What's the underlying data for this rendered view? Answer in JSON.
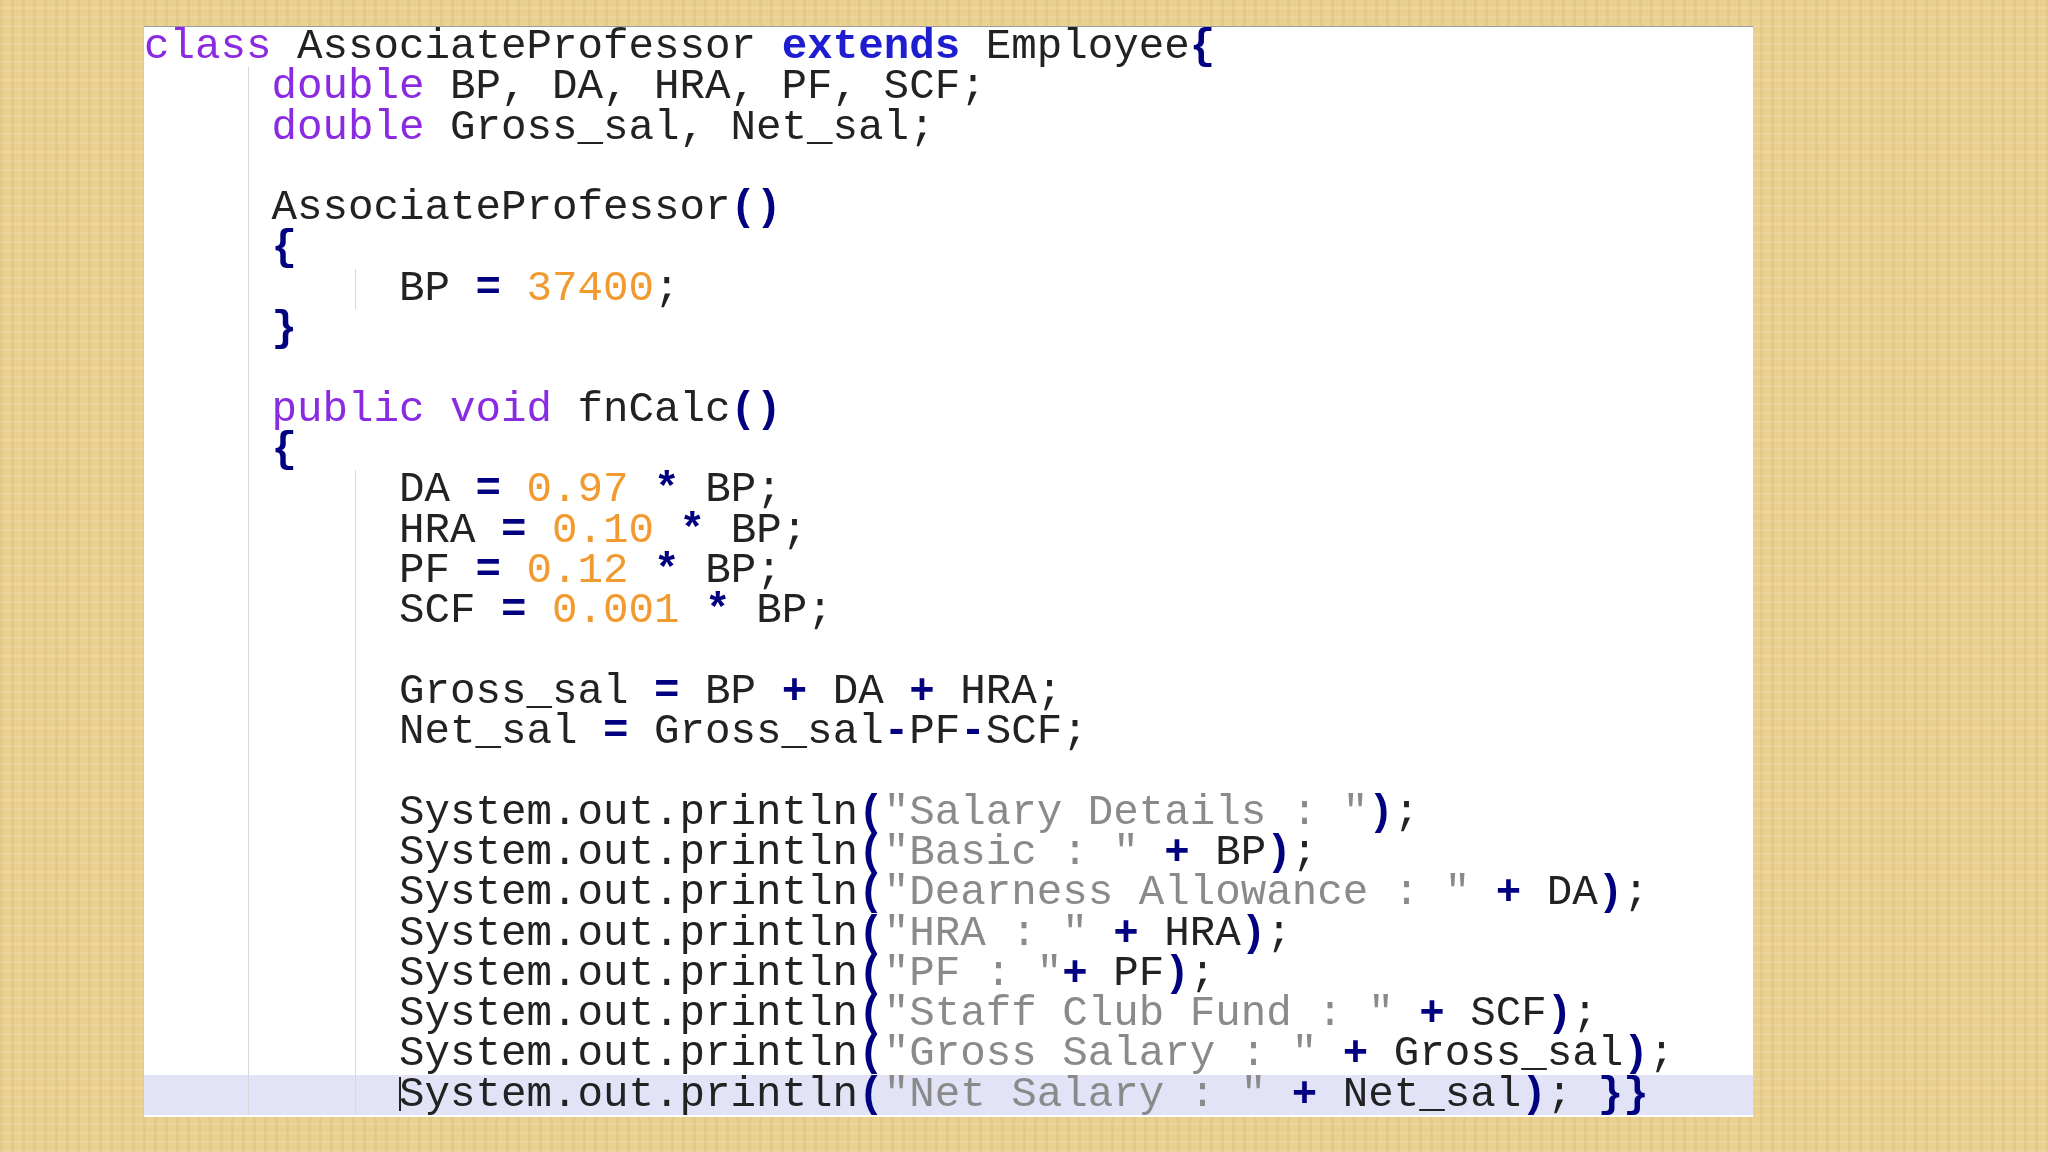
{
  "editor": {
    "lines": [
      {
        "kind": "code",
        "current": false,
        "tokens": [
          {
            "kind": "kw",
            "text": "class"
          },
          {
            "kind": "id",
            "text": " AssociateProfessor "
          },
          {
            "kind": "kwb",
            "text": "extends"
          },
          {
            "kind": "id",
            "text": " Employee"
          },
          {
            "kind": "op",
            "text": "{"
          }
        ]
      },
      {
        "kind": "code",
        "current": false,
        "tokens": [
          {
            "kind": "kw",
            "text": "     double"
          },
          {
            "kind": "id",
            "text": " BP, DA, HRA, PF, SCF;"
          }
        ]
      },
      {
        "kind": "code",
        "current": false,
        "tokens": [
          {
            "kind": "kw",
            "text": "     double"
          },
          {
            "kind": "id",
            "text": " Gross_sal, Net_sal;"
          }
        ]
      },
      {
        "kind": "blank",
        "current": false
      },
      {
        "kind": "code",
        "current": false,
        "tokens": [
          {
            "kind": "id",
            "text": "     AssociateProfessor"
          },
          {
            "kind": "op",
            "text": "()"
          }
        ]
      },
      {
        "kind": "code",
        "current": false,
        "tokens": [
          {
            "kind": "op",
            "text": "     {"
          }
        ]
      },
      {
        "kind": "code",
        "current": false,
        "tokens": [
          {
            "kind": "id",
            "text": "          BP "
          },
          {
            "kind": "op",
            "text": "="
          },
          {
            "kind": "num",
            "text": " 37400"
          },
          {
            "kind": "id",
            "text": ";"
          }
        ]
      },
      {
        "kind": "code",
        "current": false,
        "tokens": [
          {
            "kind": "op",
            "text": "     }"
          }
        ]
      },
      {
        "kind": "blank",
        "current": false
      },
      {
        "kind": "code",
        "current": false,
        "tokens": [
          {
            "kind": "kw",
            "text": "     public void"
          },
          {
            "kind": "id",
            "text": " fnCalc"
          },
          {
            "kind": "op",
            "text": "()"
          }
        ]
      },
      {
        "kind": "code",
        "current": false,
        "tokens": [
          {
            "kind": "op",
            "text": "     {"
          }
        ]
      },
      {
        "kind": "code",
        "current": false,
        "tokens": [
          {
            "kind": "id",
            "text": "          DA "
          },
          {
            "kind": "op",
            "text": "="
          },
          {
            "kind": "num",
            "text": " 0.97"
          },
          {
            "kind": "op",
            "text": " *"
          },
          {
            "kind": "id",
            "text": " BP;"
          }
        ]
      },
      {
        "kind": "code",
        "current": false,
        "tokens": [
          {
            "kind": "id",
            "text": "          HRA "
          },
          {
            "kind": "op",
            "text": "="
          },
          {
            "kind": "num",
            "text": " 0.10"
          },
          {
            "kind": "op",
            "text": " *"
          },
          {
            "kind": "id",
            "text": " BP;"
          }
        ]
      },
      {
        "kind": "code",
        "current": false,
        "tokens": [
          {
            "kind": "id",
            "text": "          PF "
          },
          {
            "kind": "op",
            "text": "="
          },
          {
            "kind": "num",
            "text": " 0.12"
          },
          {
            "kind": "op",
            "text": " *"
          },
          {
            "kind": "id",
            "text": " BP;"
          }
        ]
      },
      {
        "kind": "code",
        "current": false,
        "tokens": [
          {
            "kind": "id",
            "text": "          SCF "
          },
          {
            "kind": "op",
            "text": "="
          },
          {
            "kind": "num",
            "text": " 0.001"
          },
          {
            "kind": "op",
            "text": " *"
          },
          {
            "kind": "id",
            "text": " BP;"
          }
        ]
      },
      {
        "kind": "blank",
        "current": false
      },
      {
        "kind": "code",
        "current": false,
        "tokens": [
          {
            "kind": "id",
            "text": "          Gross_sal "
          },
          {
            "kind": "op",
            "text": "="
          },
          {
            "kind": "id",
            "text": " BP "
          },
          {
            "kind": "op",
            "text": "+"
          },
          {
            "kind": "id",
            "text": " DA "
          },
          {
            "kind": "op",
            "text": "+"
          },
          {
            "kind": "id",
            "text": " HRA;"
          }
        ]
      },
      {
        "kind": "code",
        "current": false,
        "tokens": [
          {
            "kind": "id",
            "text": "          Net_sal "
          },
          {
            "kind": "op",
            "text": "="
          },
          {
            "kind": "id",
            "text": " Gross_sal"
          },
          {
            "kind": "op",
            "text": "-"
          },
          {
            "kind": "id",
            "text": "PF"
          },
          {
            "kind": "op",
            "text": "-"
          },
          {
            "kind": "id",
            "text": "SCF;"
          }
        ]
      },
      {
        "kind": "blank",
        "current": false
      },
      {
        "kind": "code",
        "current": false,
        "tokens": [
          {
            "kind": "id",
            "text": "          System.out.println"
          },
          {
            "kind": "op",
            "text": "("
          },
          {
            "kind": "str",
            "text": "\"Salary Details : \""
          },
          {
            "kind": "op",
            "text": ")"
          },
          {
            "kind": "id",
            "text": ";"
          }
        ]
      },
      {
        "kind": "code",
        "current": false,
        "tokens": [
          {
            "kind": "id",
            "text": "          System.out.println"
          },
          {
            "kind": "op",
            "text": "("
          },
          {
            "kind": "str",
            "text": "\"Basic : \""
          },
          {
            "kind": "op",
            "text": " +"
          },
          {
            "kind": "id",
            "text": " BP"
          },
          {
            "kind": "op",
            "text": ")"
          },
          {
            "kind": "id",
            "text": ";"
          }
        ]
      },
      {
        "kind": "code",
        "current": false,
        "tokens": [
          {
            "kind": "id",
            "text": "          System.out.println"
          },
          {
            "kind": "op",
            "text": "("
          },
          {
            "kind": "str",
            "text": "\"Dearness Allowance : \""
          },
          {
            "kind": "op",
            "text": " +"
          },
          {
            "kind": "id",
            "text": " DA"
          },
          {
            "kind": "op",
            "text": ")"
          },
          {
            "kind": "id",
            "text": ";"
          }
        ]
      },
      {
        "kind": "code",
        "current": false,
        "tokens": [
          {
            "kind": "id",
            "text": "          System.out.println"
          },
          {
            "kind": "op",
            "text": "("
          },
          {
            "kind": "str",
            "text": "\"HRA : \""
          },
          {
            "kind": "op",
            "text": " +"
          },
          {
            "kind": "id",
            "text": " HRA"
          },
          {
            "kind": "op",
            "text": ")"
          },
          {
            "kind": "id",
            "text": ";"
          }
        ]
      },
      {
        "kind": "code",
        "current": false,
        "tokens": [
          {
            "kind": "id",
            "text": "          System.out.println"
          },
          {
            "kind": "op",
            "text": "("
          },
          {
            "kind": "str",
            "text": "\"PF : \""
          },
          {
            "kind": "op",
            "text": "+"
          },
          {
            "kind": "id",
            "text": " PF"
          },
          {
            "kind": "op",
            "text": ")"
          },
          {
            "kind": "id",
            "text": ";"
          }
        ]
      },
      {
        "kind": "code",
        "current": false,
        "tokens": [
          {
            "kind": "id",
            "text": "          System.out.println"
          },
          {
            "kind": "op",
            "text": "("
          },
          {
            "kind": "str",
            "text": "\"Staff Club Fund : \""
          },
          {
            "kind": "op",
            "text": " +"
          },
          {
            "kind": "id",
            "text": " SCF"
          },
          {
            "kind": "op",
            "text": ")"
          },
          {
            "kind": "id",
            "text": ";"
          }
        ]
      },
      {
        "kind": "code",
        "current": false,
        "tokens": [
          {
            "kind": "id",
            "text": "          System.out.println"
          },
          {
            "kind": "op",
            "text": "("
          },
          {
            "kind": "str",
            "text": "\"Gross Salary : \""
          },
          {
            "kind": "op",
            "text": " +"
          },
          {
            "kind": "id",
            "text": " Gross_sal"
          },
          {
            "kind": "op",
            "text": ")"
          },
          {
            "kind": "id",
            "text": ";"
          }
        ]
      },
      {
        "kind": "code",
        "current": true,
        "tokens": [
          {
            "kind": "id",
            "text": "          System.out.println"
          },
          {
            "kind": "op",
            "text": "("
          },
          {
            "kind": "str",
            "text": "\"Net Salary : \""
          },
          {
            "kind": "op",
            "text": " +"
          },
          {
            "kind": "id",
            "text": " Net_sal"
          },
          {
            "kind": "op",
            "text": ")"
          },
          {
            "kind": "id",
            "text": ";"
          },
          {
            "kind": "op",
            "text": " }}"
          }
        ]
      }
    ]
  }
}
